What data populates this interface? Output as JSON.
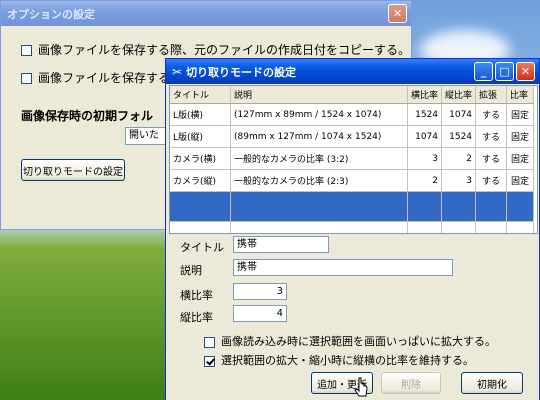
{
  "options_window": {
    "title": "オプションの設定",
    "checkbox1_label": "画像ファイルを保存する際、元のファイルの作成日付をコピーする。",
    "checkbox2_label": "画像ファイルを保存する",
    "section_label": "画像保存時の初期フォル",
    "folder_value": "開いた",
    "crop_mode_button": "切り取りモードの設定"
  },
  "crop_window": {
    "title": "切り取りモードの設定",
    "columns": [
      "タイトル",
      "説明",
      "横比率",
      "縦比率",
      "拡張",
      "比率"
    ],
    "rows": [
      {
        "title": "L版(横)",
        "desc": "(127mm x 89mm / 1524 x 1074)",
        "w": "1524",
        "h": "1074",
        "ext": "する",
        "ratio": "固定"
      },
      {
        "title": "L版(縦)",
        "desc": "(89mm x 127mm / 1074 x 1524)",
        "w": "1074",
        "h": "1524",
        "ext": "する",
        "ratio": "固定"
      },
      {
        "title": "カメラ(横)",
        "desc": "一般的なカメラの比率 (3:2)",
        "w": "3",
        "h": "2",
        "ext": "する",
        "ratio": "固定"
      },
      {
        "title": "カメラ(縦)",
        "desc": "一般的なカメラの比率 (2:3)",
        "w": "2",
        "h": "3",
        "ext": "する",
        "ratio": "固定"
      }
    ],
    "form": {
      "title_label": "タイトル",
      "title_value": "携帯",
      "desc_label": "説明",
      "desc_value": "携帯",
      "w_label": "横比率",
      "w_value": "3",
      "h_label": "縦比率",
      "h_value": "4"
    },
    "check_expand": {
      "label": "画像読み込み時に選択範囲を画面いっぱいに拡大する。",
      "checked": false
    },
    "check_keep_ratio": {
      "label": "選択範囲の拡大・縮小時に縦横の比率を維持する。",
      "checked": true
    },
    "buttons": {
      "add_update": "追加・更新",
      "delete": "削除",
      "reset": "初期化"
    }
  },
  "colors": {
    "selection": "#316ac5",
    "titlebar": "#0046d5",
    "window_bg": "#ece9d8"
  },
  "icons": [
    "close-icon",
    "minimize-icon",
    "maximize-icon",
    "scissors-icon",
    "mouse-cursor-icon"
  ]
}
